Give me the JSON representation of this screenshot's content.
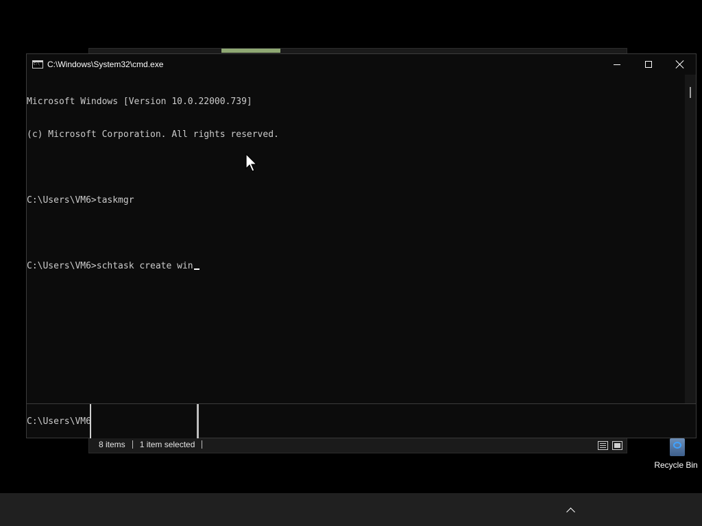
{
  "cmd_window": {
    "title": "C:\\Windows\\System32\\cmd.exe",
    "console_lines": [
      "Microsoft Windows [Version 10.0.22000.739]",
      "(c) Microsoft Corporation. All rights reserved.",
      "",
      "C:\\Users\\VM6>taskmgr",
      "",
      "C:\\Users\\VM6>schtask create win"
    ]
  },
  "background_cmd": {
    "prompt": "C:\\Users\\VM6"
  },
  "explorer": {
    "status_items": "8 items",
    "status_selected": "1 item selected"
  },
  "desktop": {
    "recycle_bin_label": "Recycle Bin"
  },
  "colors": {
    "console_bg": "#0c0c0c",
    "console_text": "#cccccc",
    "taskbar_bg": "#202020"
  }
}
